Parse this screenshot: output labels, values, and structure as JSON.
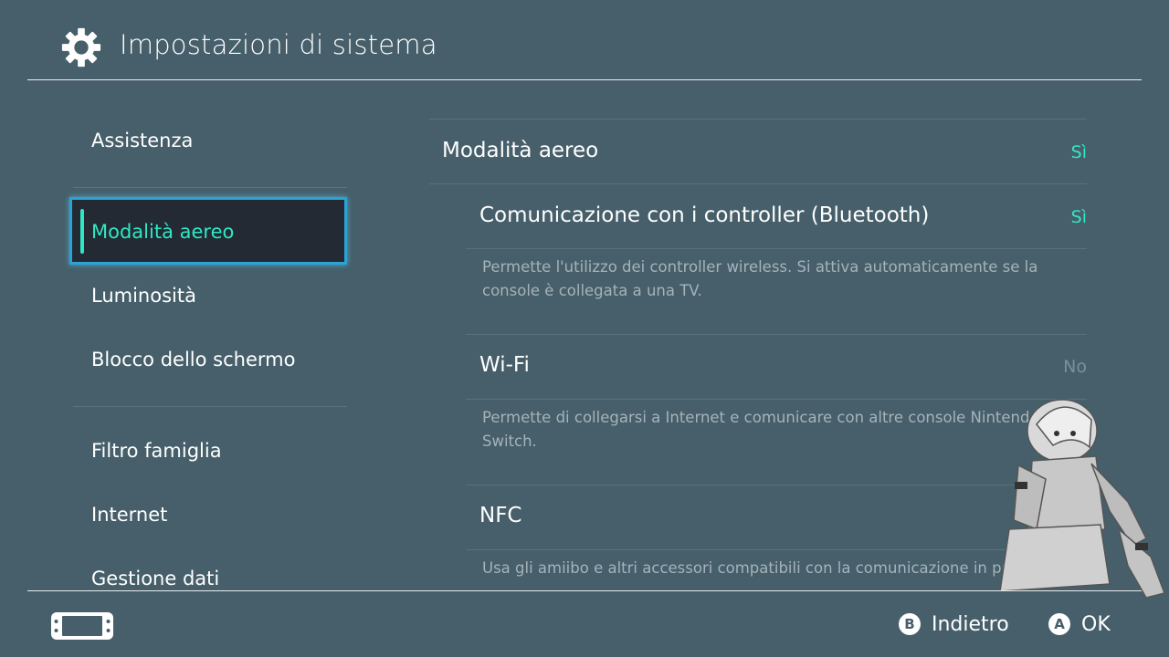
{
  "header": {
    "title": "Impostazioni di sistema",
    "icon": "gear-icon"
  },
  "sidebar": {
    "items": [
      {
        "label": "Assistenza"
      },
      {
        "label": "Modalità aereo",
        "selected": true
      },
      {
        "label": "Luminosità"
      },
      {
        "label": "Blocco dello schermo"
      },
      {
        "label": "Filtro famiglia"
      },
      {
        "label": "Internet"
      },
      {
        "label": "Gestione dati"
      }
    ]
  },
  "main": {
    "airplane": {
      "label": "Modalità aereo",
      "value": "Sì"
    },
    "bluetooth": {
      "label": "Comunicazione con i controller (Bluetooth)",
      "value": "Sì",
      "description": "Permette l'utilizzo dei controller wireless. Si attiva automaticamente se la console è collegata a una TV."
    },
    "wifi": {
      "label": "Wi-Fi",
      "value": "No",
      "description": "Permette di collegarsi a Internet e comunicare con altre console Nintendo Switch."
    },
    "nfc": {
      "label": "NFC",
      "description": "Usa gli amiibo e altri accessori compatibili con la comunicazione in prossimità."
    }
  },
  "footer": {
    "console_icon": "handheld-console-icon",
    "back": {
      "button": "B",
      "label": "Indietro"
    },
    "ok": {
      "button": "A",
      "label": "OK"
    }
  },
  "colors": {
    "background": "#465f6a",
    "accent_on": "#35e6c8",
    "selection_border": "#2ba3d6",
    "selection_bg": "#232a33"
  },
  "overlay": {
    "icon": "anime-character-sticker"
  }
}
